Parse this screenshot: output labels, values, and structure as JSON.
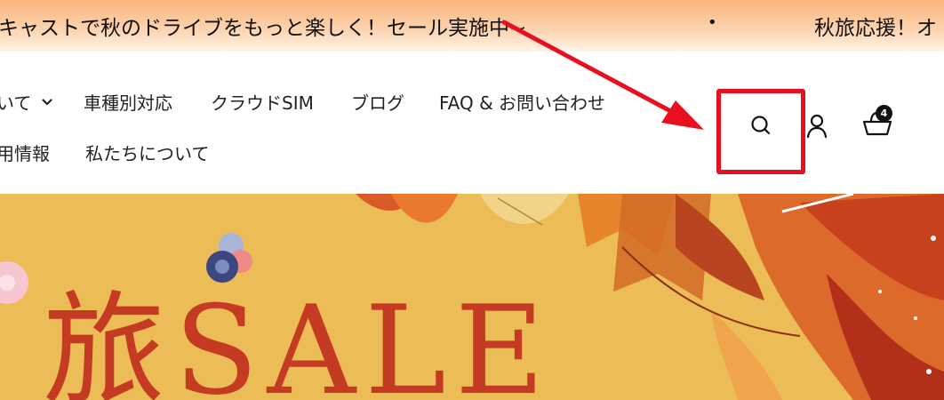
{
  "announcement": {
    "message_1": "キャストで秋のドライブをもっと楽しく！セール実施中~",
    "separator": "•",
    "message_2": "秋旅応援！オ"
  },
  "nav": {
    "row1": [
      {
        "label": "いて",
        "has_dropdown": true
      },
      {
        "label": "車種別対応"
      },
      {
        "label": "クラウドSIM"
      },
      {
        "label": "ブログ"
      },
      {
        "label": "FAQ & お問い合わせ"
      }
    ],
    "row2": [
      {
        "label": "用情報"
      },
      {
        "label": "私たちについて"
      }
    ]
  },
  "header_icons": {
    "search": "search-icon",
    "account": "account-icon",
    "cart": "cart-icon",
    "cart_count": "4"
  },
  "annotation": {
    "box_color": "#e8101e",
    "arrow_color": "#e8101e"
  },
  "hero": {
    "title": "旅SALE",
    "background_color": "#ecbc57",
    "title_color": "#c53a22"
  }
}
